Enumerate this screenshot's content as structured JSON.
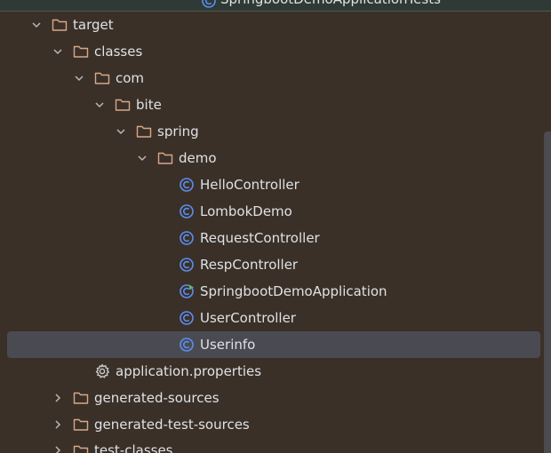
{
  "tree": {
    "top_cutoff_label": "SpringbootDemoApplicationTests",
    "items": [
      {
        "label": "target",
        "icon": "folder-icon",
        "expanded": true
      },
      {
        "label": "classes",
        "icon": "folder-icon",
        "expanded": true
      },
      {
        "label": "com",
        "icon": "folder-icon",
        "expanded": true
      },
      {
        "label": "bite",
        "icon": "folder-icon",
        "expanded": true
      },
      {
        "label": "spring",
        "icon": "folder-icon",
        "expanded": true
      },
      {
        "label": "demo",
        "icon": "folder-icon",
        "expanded": true
      },
      {
        "label": "HelloController",
        "icon": "class-icon"
      },
      {
        "label": "LombokDemo",
        "icon": "class-icon"
      },
      {
        "label": "RequestController",
        "icon": "class-icon"
      },
      {
        "label": "RespController",
        "icon": "class-icon"
      },
      {
        "label": "SpringbootDemoApplication",
        "icon": "runnable-class-icon"
      },
      {
        "label": "UserController",
        "icon": "class-icon"
      },
      {
        "label": "Userinfo",
        "icon": "class-icon",
        "selected": true
      },
      {
        "label": "application.properties",
        "icon": "gear-icon"
      },
      {
        "label": "generated-sources",
        "icon": "folder-icon",
        "expanded": false
      },
      {
        "label": "generated-test-sources",
        "icon": "folder-icon",
        "expanded": false
      },
      {
        "label": "test-classes",
        "icon": "folder-icon",
        "expanded": false
      }
    ]
  },
  "colors": {
    "background": "#3a3028",
    "selection": "#4a4b52",
    "folder_stroke": "#d7a78a",
    "class_icon": "#5b8ef0",
    "run_badge": "#5fb865",
    "text": "#dfe1e5"
  }
}
